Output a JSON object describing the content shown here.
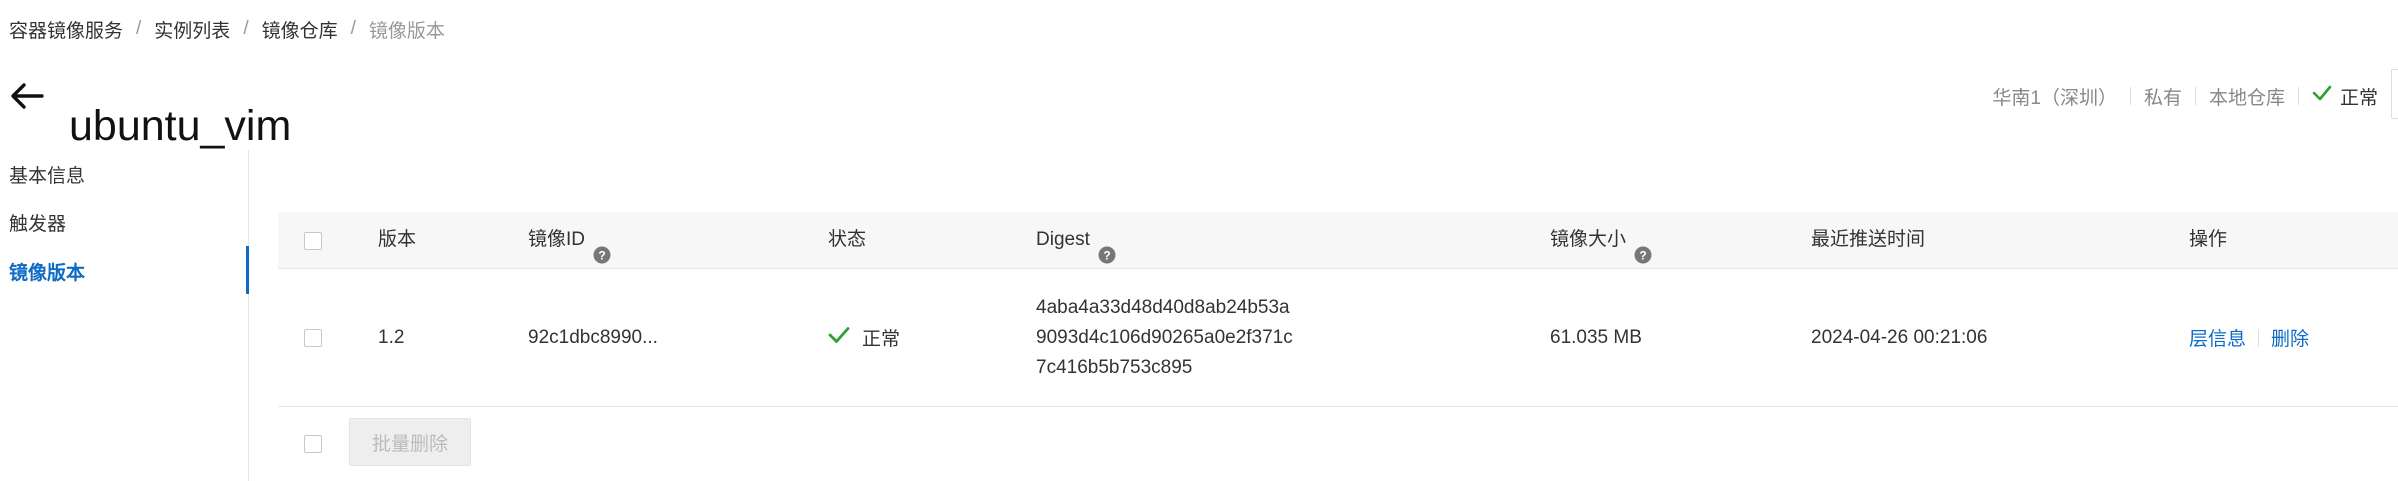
{
  "breadcrumb": {
    "items": [
      "容器镜像服务",
      "实例列表",
      "镜像仓库"
    ],
    "current": "镜像版本",
    "separator": "/"
  },
  "header": {
    "title": "ubuntu_vim",
    "region": "华南1（深圳）",
    "visibility": "私有",
    "repo_type": "本地仓库",
    "status": "正常"
  },
  "sidebar": {
    "items": [
      {
        "label": "基本信息",
        "active": false
      },
      {
        "label": "触发器",
        "active": false
      },
      {
        "label": "镜像版本",
        "active": true
      }
    ]
  },
  "table": {
    "columns": {
      "version": "版本",
      "image_id": "镜像ID",
      "status": "状态",
      "digest": "Digest",
      "size": "镜像大小",
      "pushed": "最近推送时间",
      "actions": "操作"
    },
    "rows": [
      {
        "version": "1.2",
        "image_id": "92c1dbc8990...",
        "status": "正常",
        "digest_lines": [
          "4aba4a33d48d40d8ab24b53a",
          "9093d4c106d90265a0e2f371c",
          "7c416b5b753c895"
        ],
        "size": "61.035 MB",
        "pushed": "2024-04-26 00:21:06",
        "actions": [
          "层信息",
          "删除"
        ]
      }
    ],
    "batch_delete_label": "批量删除"
  },
  "colors": {
    "accent": "#0d6bc6",
    "success": "#2ba32b",
    "muted": "#999999"
  }
}
